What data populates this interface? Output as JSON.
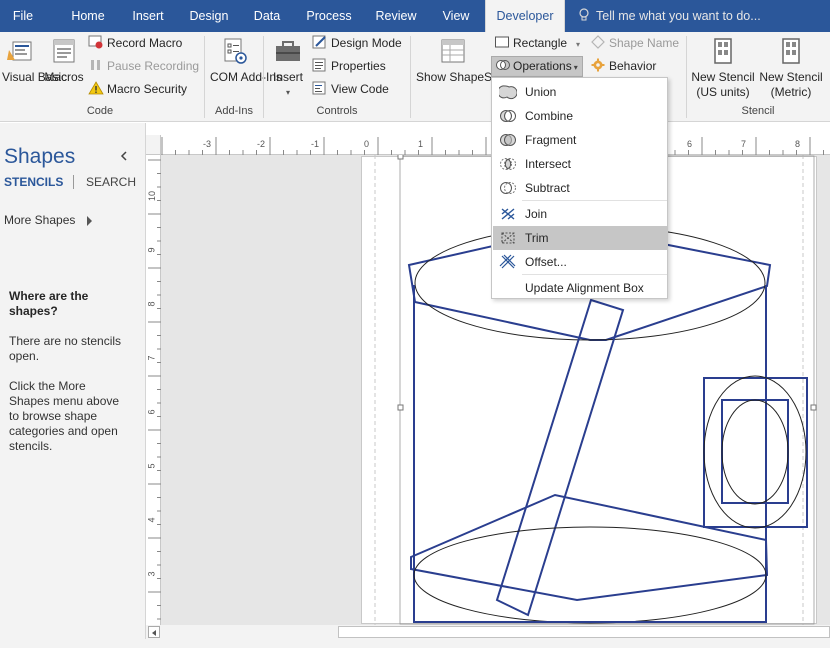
{
  "tabs": [
    {
      "label": "File"
    },
    {
      "label": "Home"
    },
    {
      "label": "Insert"
    },
    {
      "label": "Design"
    },
    {
      "label": "Data"
    },
    {
      "label": "Process"
    },
    {
      "label": "Review"
    },
    {
      "label": "View"
    },
    {
      "label": "Developer",
      "active": true
    }
  ],
  "tell_me": "Tell me what you want to do...",
  "ribbon": {
    "code": {
      "label": "Code",
      "visual_basic": "Visual Basic",
      "macros": "Macros",
      "record_macro": "Record Macro",
      "pause_recording": "Pause Recording",
      "macro_security": "Macro Security"
    },
    "addins": {
      "label": "Add-Ins",
      "com_addins": "COM Add-Ins"
    },
    "controls": {
      "label": "Controls",
      "insert": "Insert",
      "design_mode": "Design Mode",
      "properties": "Properties",
      "view_code": "View Code"
    },
    "shape_design": {
      "show_shapesheet": "Show ShapeSheet",
      "rectangle": "Rectangle",
      "operations": "Operations",
      "shape_name": "Shape Name",
      "behavior": "Behavior"
    },
    "stencil": {
      "label": "Stencil",
      "new_stencil_us": "New Stencil (US units)",
      "new_stencil_metric": "New Stencil (Metric)"
    }
  },
  "operations_menu": [
    {
      "label": "Union",
      "icon": "union-icon"
    },
    {
      "label": "Combine",
      "icon": "combine-icon"
    },
    {
      "label": "Fragment",
      "icon": "fragment-icon"
    },
    {
      "label": "Intersect",
      "icon": "intersect-icon"
    },
    {
      "label": "Subtract",
      "icon": "subtract-icon"
    },
    {
      "label": "Join",
      "icon": "join-icon"
    },
    {
      "label": "Trim",
      "icon": "trim-icon",
      "highlighted": true
    },
    {
      "label": "Offset...",
      "icon": "offset-icon"
    },
    {
      "label": "Update Alignment Box",
      "icon": ""
    }
  ],
  "shapes_panel": {
    "title": "Shapes",
    "tab_stencils": "STENCILS",
    "tab_search": "SEARCH",
    "more_shapes": "More Shapes",
    "where_title": "Where are the shapes?",
    "no_stencils": "There are no stencils open.",
    "click_more": "Click the More Shapes menu above to browse shape categories and open stencils."
  },
  "ruler": {
    "horizontal": [
      "-3",
      "-2",
      "-1",
      "0",
      "1",
      "6",
      "7",
      "8"
    ],
    "vertical": [
      "10",
      "9",
      "8",
      "7",
      "6",
      "5",
      "4",
      "3"
    ]
  },
  "colors": {
    "accent": "#2b579a",
    "shape_stroke": "#2a3e8f",
    "menu_highlight": "#c6c6c6"
  }
}
